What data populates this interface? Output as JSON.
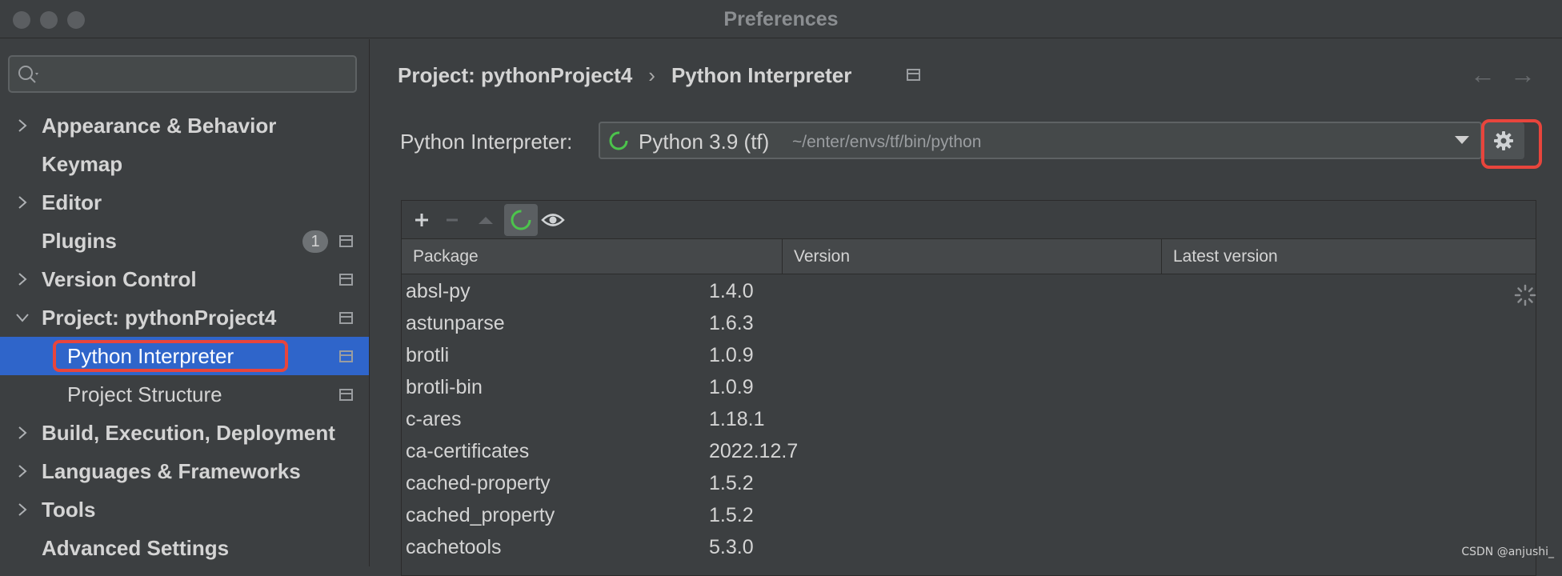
{
  "window": {
    "title": "Preferences"
  },
  "search": {
    "placeholder": ""
  },
  "sidebar": {
    "items": [
      {
        "label": "Appearance & Behavior"
      },
      {
        "label": "Keymap"
      },
      {
        "label": "Editor"
      },
      {
        "label": "Plugins",
        "badge": "1"
      },
      {
        "label": "Version Control"
      },
      {
        "label": "Project: pythonProject4"
      },
      {
        "label": "Python Interpreter"
      },
      {
        "label": "Project Structure"
      },
      {
        "label": "Build, Execution, Deployment"
      },
      {
        "label": "Languages & Frameworks"
      },
      {
        "label": "Tools"
      },
      {
        "label": "Advanced Settings"
      }
    ]
  },
  "breadcrumb": {
    "project": "Project: pythonProject4",
    "separator": "›",
    "page": "Python Interpreter"
  },
  "nav": {
    "back": "←",
    "forward": "→"
  },
  "interpreter": {
    "label": "Python Interpreter:",
    "name": "Python 3.9 (tf)",
    "path": "~/enter/envs/tf/bin/python"
  },
  "toolbar": {
    "add": "+",
    "remove": "−"
  },
  "table": {
    "columns": [
      "Package",
      "Version",
      "Latest version"
    ],
    "rows": [
      {
        "package": "absl-py",
        "version": "1.4.0"
      },
      {
        "package": "astunparse",
        "version": "1.6.3"
      },
      {
        "package": "brotli",
        "version": "1.0.9"
      },
      {
        "package": "brotli-bin",
        "version": "1.0.9"
      },
      {
        "package": "c-ares",
        "version": "1.18.1"
      },
      {
        "package": "ca-certificates",
        "version": "2022.12.7"
      },
      {
        "package": "cached-property",
        "version": "1.5.2"
      },
      {
        "package": "cached_property",
        "version": "1.5.2"
      },
      {
        "package": "cachetools",
        "version": "5.3.0"
      }
    ]
  },
  "colors": {
    "selection": "#2f65ca",
    "highlight": "#e8453c",
    "spinner": "#4cc44c"
  },
  "watermark": "CSDN @anjushi_"
}
